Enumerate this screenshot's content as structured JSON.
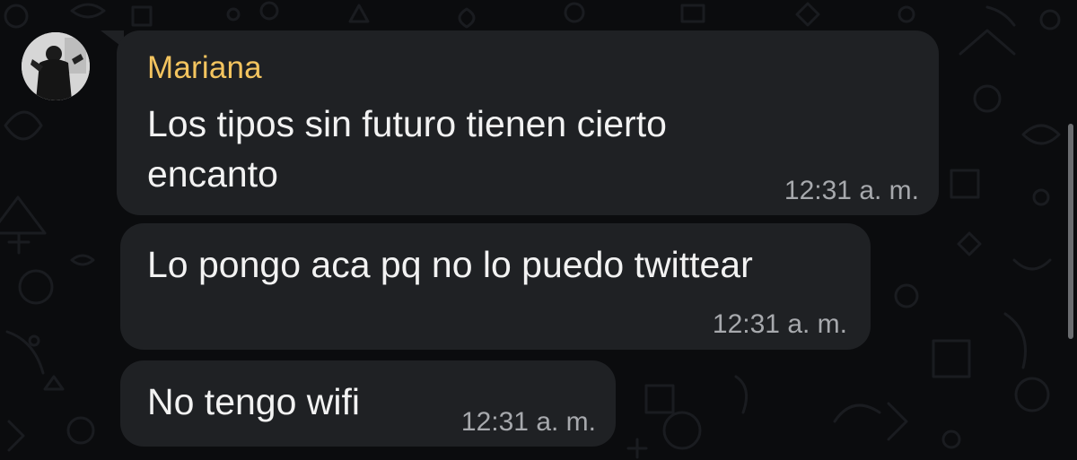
{
  "chat": {
    "sender": "Mariana",
    "messages": [
      {
        "text_lines": [
          "Los tipos sin futuro tienen cierto",
          "encanto"
        ],
        "time": "12:31 a. m."
      },
      {
        "text": "Lo pongo aca pq no lo puedo twittear",
        "time": "12:31 a. m."
      },
      {
        "text": "No tengo wifi",
        "time": "12:31 a. m."
      }
    ]
  },
  "colors": {
    "background": "#0b0c0e",
    "bubble": "#1f2124",
    "sender_name": "#f3c45f",
    "message_text": "#f2f2f2",
    "timestamp": "#a7a9ad"
  },
  "icons": [
    "avatar-photo",
    "wallpaper-doodles"
  ]
}
